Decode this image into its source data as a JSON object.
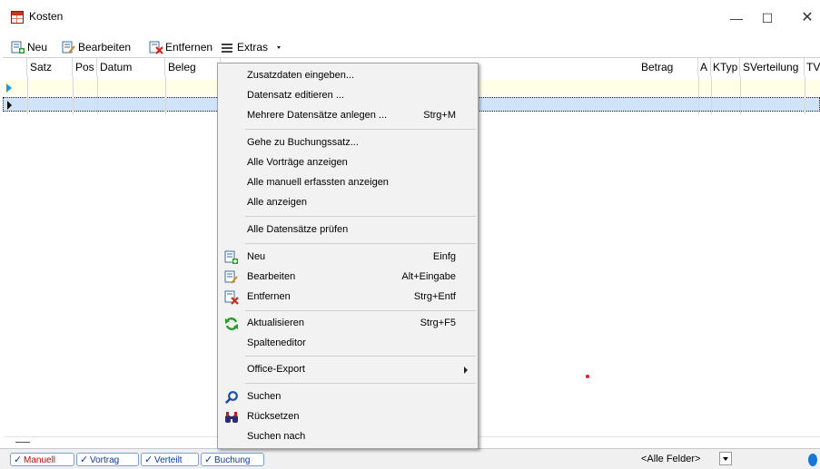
{
  "window": {
    "title": "Kosten",
    "minimize_glyph": "—",
    "maximize_glyph": "☐",
    "close_glyph": "✕"
  },
  "toolbar": {
    "new_label": "Neu",
    "edit_label": "Bearbeiten",
    "remove_label": "Entfernen",
    "extras_label": "Extras"
  },
  "grid": {
    "columns": [
      "Satz",
      "Pos",
      "Datum",
      "Beleg",
      "Betrag",
      "A",
      "KTyp",
      "SVerteilung",
      "TV"
    ],
    "bottom_dash": "—"
  },
  "menu": {
    "items": [
      {
        "label": "Zusatzdaten eingeben...",
        "shortcut": ""
      },
      {
        "label": "Datensatz editieren ...",
        "shortcut": ""
      },
      {
        "label": "Mehrere Datensätze anlegen ...",
        "shortcut": "Strg+M"
      },
      {
        "label": "Gehe zu Buchungssatz...",
        "shortcut": ""
      },
      {
        "label": "Alle Vorträge anzeigen",
        "shortcut": ""
      },
      {
        "label": "Alle manuell erfassten anzeigen",
        "shortcut": ""
      },
      {
        "label": "Alle anzeigen",
        "shortcut": ""
      },
      {
        "label": "Alle Datensätze prüfen",
        "shortcut": ""
      },
      {
        "label": "Neu",
        "shortcut": "Einfg"
      },
      {
        "label": "Bearbeiten",
        "shortcut": "Alt+Eingabe"
      },
      {
        "label": "Entfernen",
        "shortcut": "Strg+Entf"
      },
      {
        "label": "Aktualisieren",
        "shortcut": "Strg+F5"
      },
      {
        "label": "Spalteneditor",
        "shortcut": ""
      },
      {
        "label": "Office-Export",
        "shortcut": ""
      },
      {
        "label": "Suchen",
        "shortcut": ""
      },
      {
        "label": "Rücksetzen",
        "shortcut": ""
      },
      {
        "label": "Suchen nach",
        "shortcut": ""
      }
    ]
  },
  "statusbar": {
    "filters": [
      "Manuell",
      "Vortrag",
      "Verteilt",
      "Buchung"
    ],
    "check_glyph": "✓",
    "field_combo": "<Alle Felder>"
  },
  "icons": {
    "app": "cost-table-icon",
    "new": "add-document-icon",
    "edit": "edit-document-icon",
    "remove": "delete-document-icon",
    "extras": "hamburger-menu-icon",
    "refresh": "refresh-icon",
    "search": "magnifier-icon",
    "reset": "binoculars-icon",
    "submenu": "chevron-right-icon"
  },
  "colors": {
    "selection": "#cfe3fb",
    "new_row": "#ffffe8",
    "accent": "#1c9bd8",
    "menu_bg": "#f2f2f2"
  }
}
